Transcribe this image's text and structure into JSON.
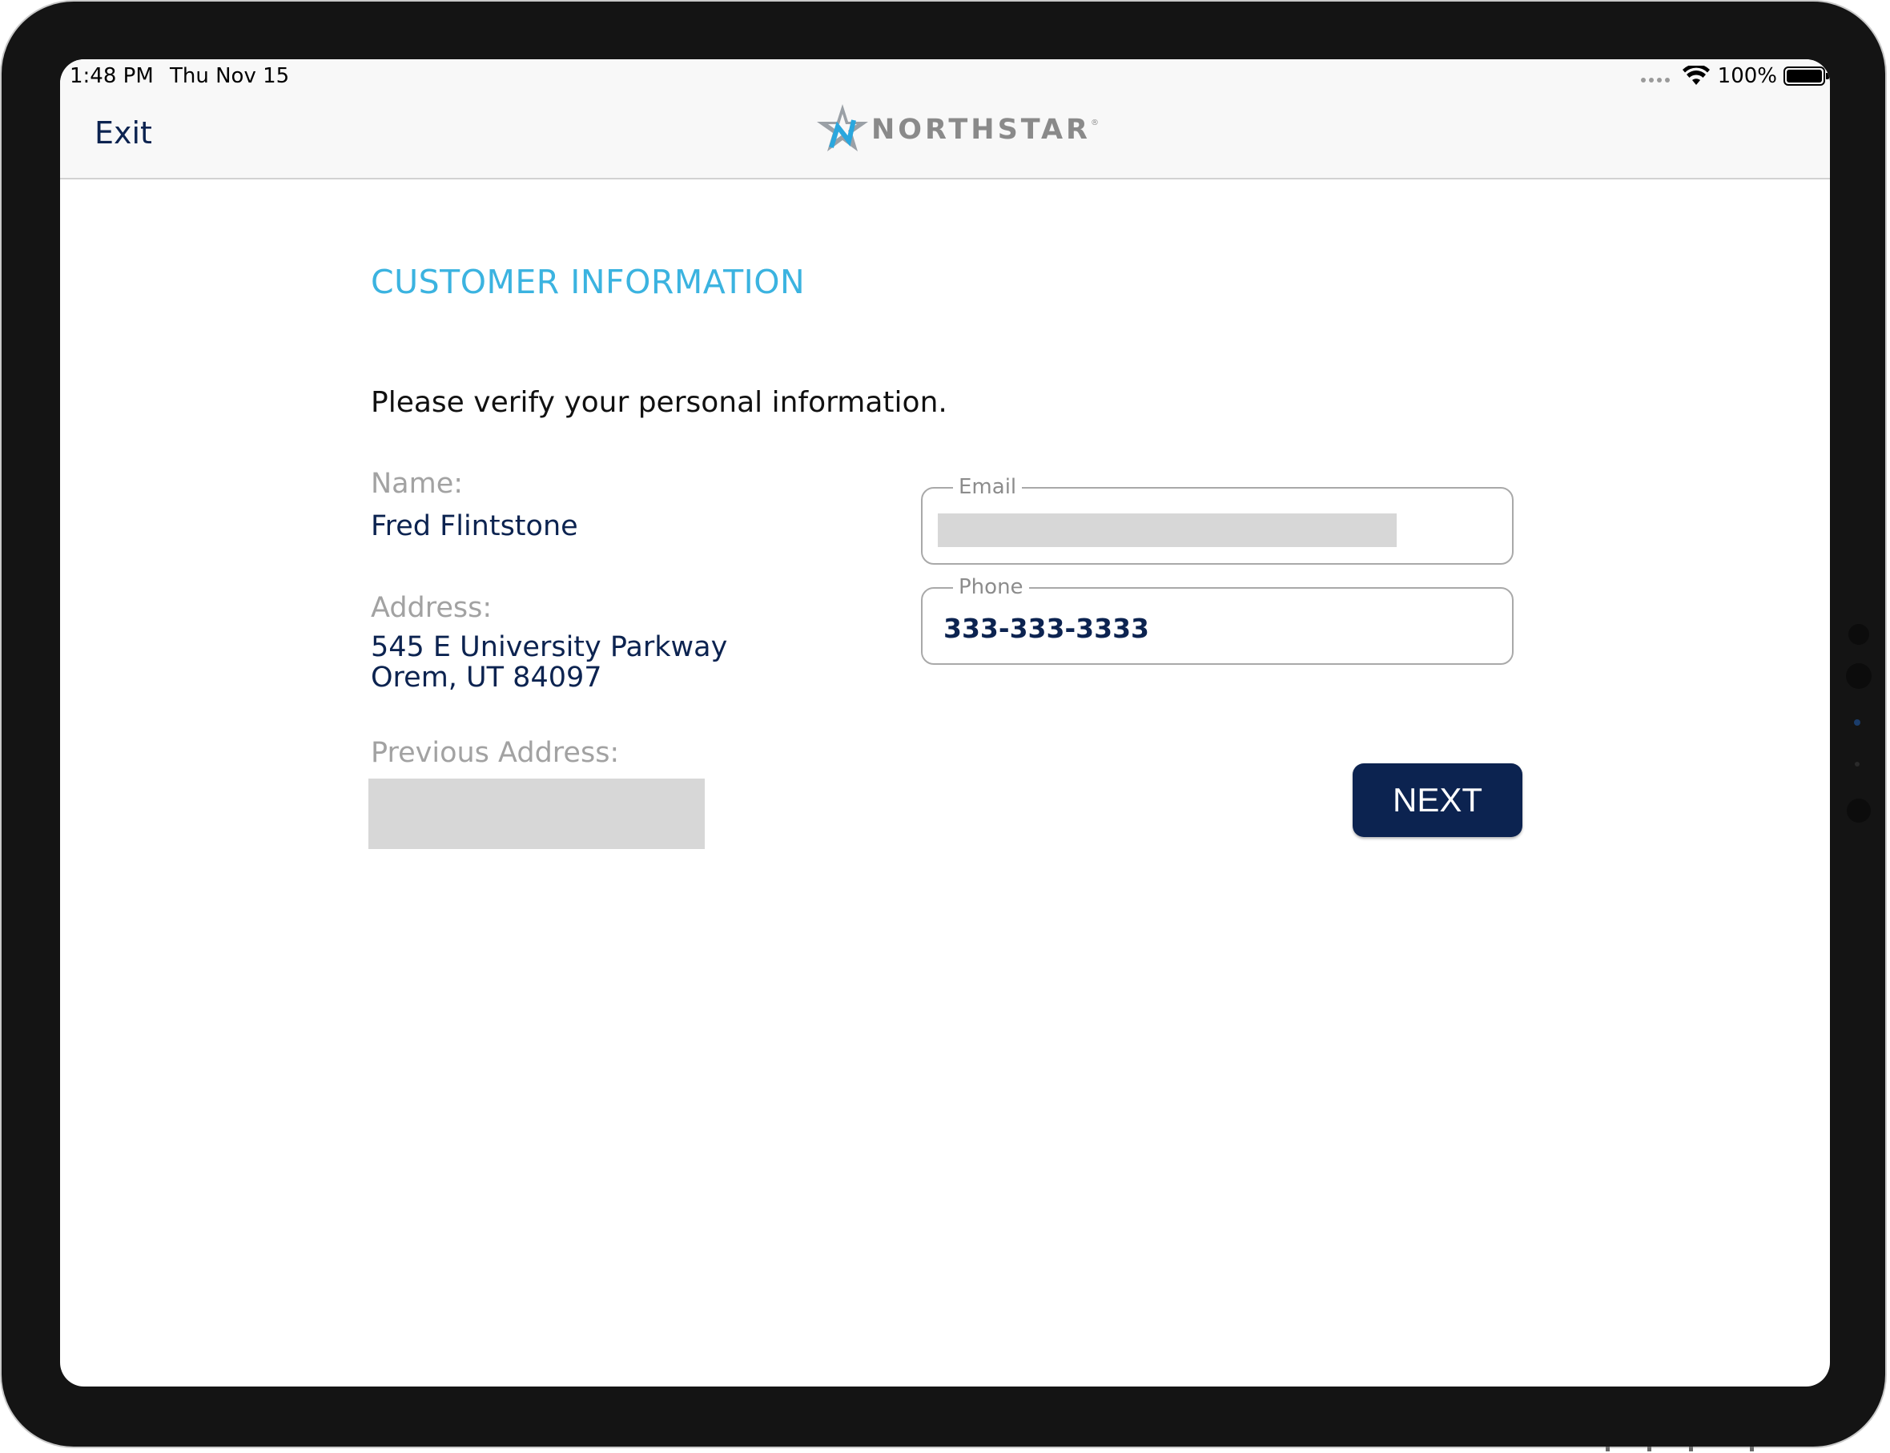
{
  "status_bar": {
    "time": "1:48 PM",
    "date": "Thu Nov 15",
    "battery": "100%"
  },
  "nav": {
    "exit_label": "Exit",
    "brand": "NORTHSTAR",
    "brand_mark": "®"
  },
  "form": {
    "title": "CUSTOMER INFORMATION",
    "instruction": "Please verify your personal information.",
    "name_label": "Name:",
    "name_value": "Fred Flintstone",
    "address_label": "Address:",
    "address_line1": "545 E University Parkway",
    "address_line2": "Orem, UT 84097",
    "previous_address_label": "Previous Address:",
    "email_label": "Email",
    "phone_label": "Phone",
    "phone_value": "333-333-3333",
    "next_label": "NEXT"
  },
  "colors": {
    "brand_navy": "#0c2350",
    "accent_blue": "#3bb3e0",
    "label_gray": "#a2a2a2",
    "redaction_gray": "#d7d7d7"
  },
  "icons": [
    "wifi-icon",
    "battery-icon",
    "cellular-signal-icon",
    "northstar-star-logo-icon"
  ]
}
